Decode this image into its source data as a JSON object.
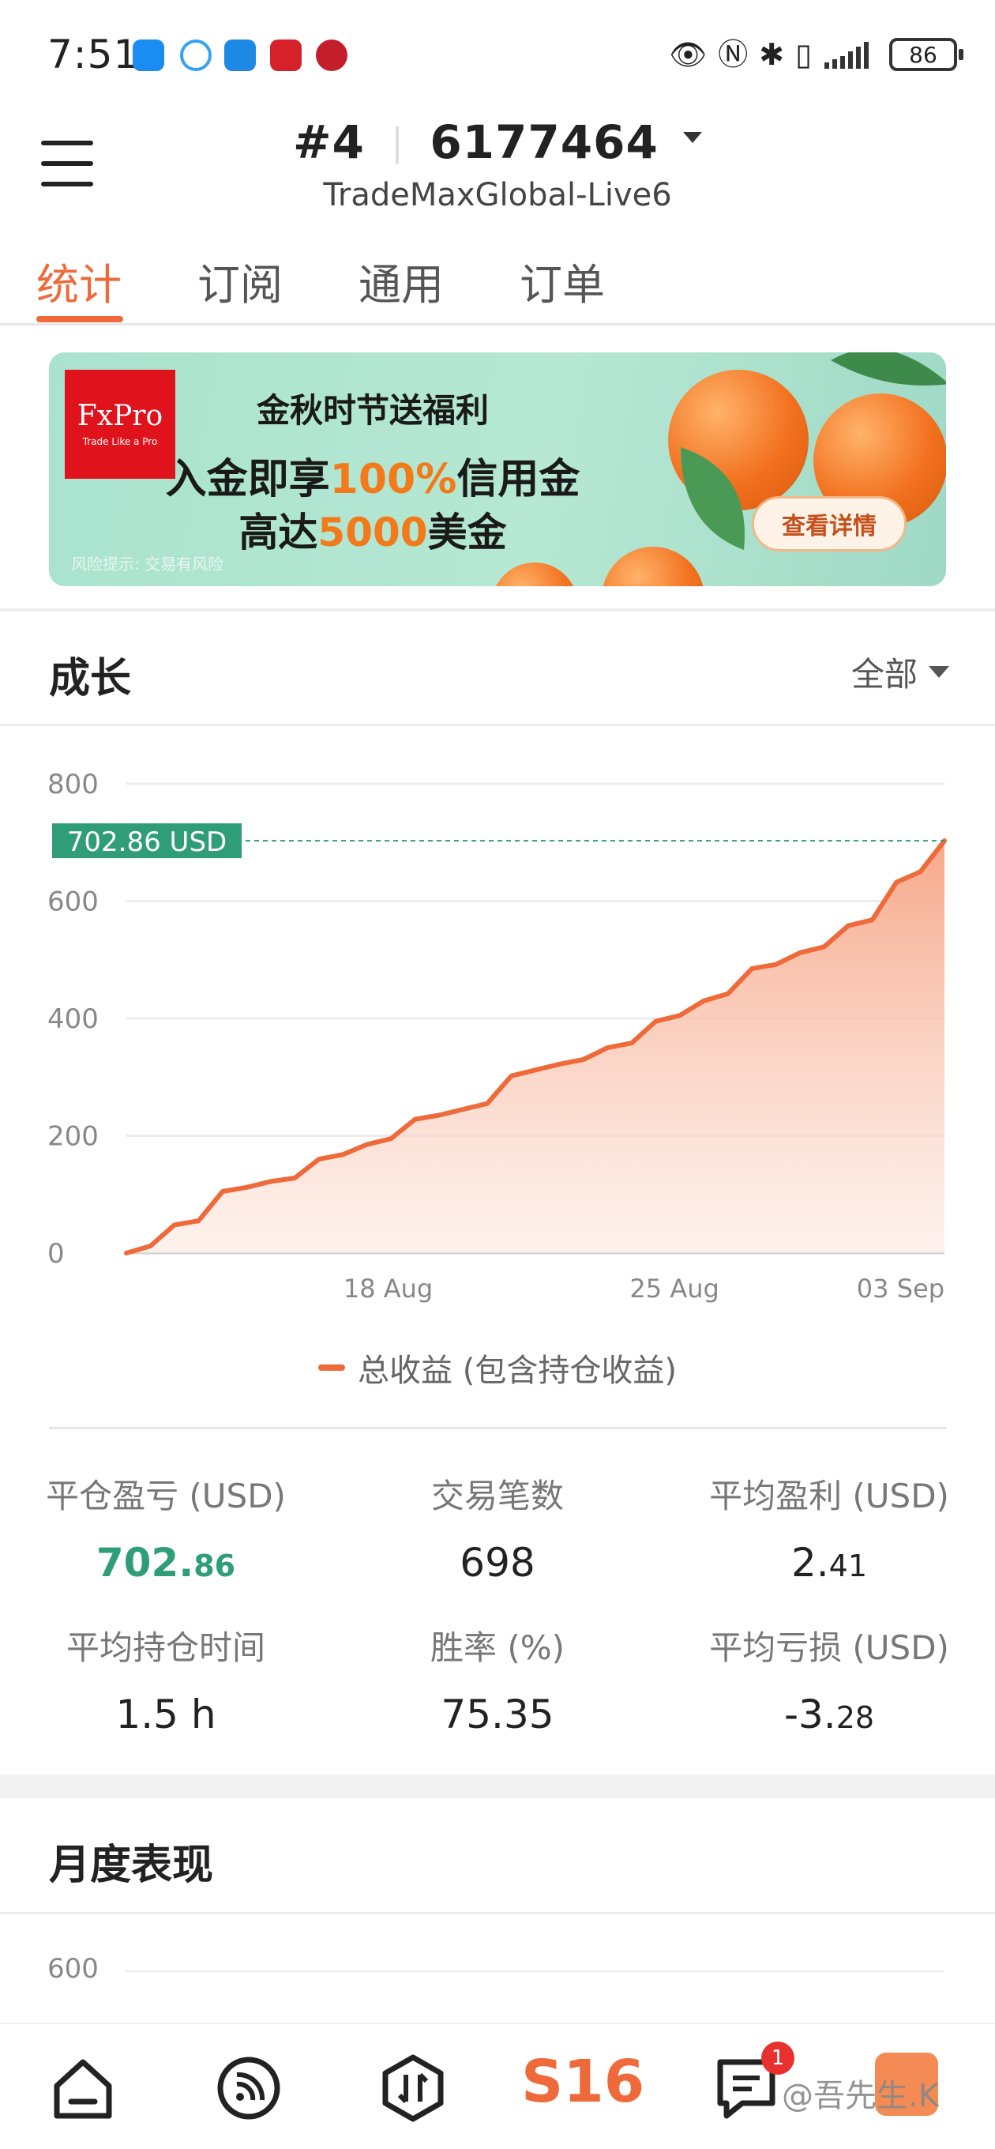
{
  "status_bar": {
    "time": "7:51",
    "battery": "86",
    "notification_icons": [
      "chat-icon",
      "weather-icon",
      "browser-icon",
      "news-icon",
      "metro-icon"
    ]
  },
  "header": {
    "account_prefix": "#4",
    "account_number": "6177464",
    "server": "TradeMaxGlobal-Live6"
  },
  "tabs": [
    {
      "label": "统计",
      "active": true
    },
    {
      "label": "订阅",
      "active": false
    },
    {
      "label": "通用",
      "active": false
    },
    {
      "label": "订单",
      "active": false
    }
  ],
  "banner": {
    "logo": "FxPro",
    "logo_tagline": "Trade Like a Pro",
    "line1": "金秋时节送福利",
    "line2_a": "入金即享",
    "line2_hl": "100%",
    "line2_b": "信用金",
    "line3_a": "高达",
    "line3_hl": "5000",
    "line3_b": "美金",
    "risk_notice": "风险提示: 交易有风险",
    "cta": "查看详情"
  },
  "growth": {
    "title": "成长",
    "filter": "全部",
    "current_label": "702.86 USD",
    "legend": "总收益 (包含持仓收益)"
  },
  "chart_data": {
    "type": "area",
    "y_ticks": [
      "800",
      "600",
      "400",
      "200",
      "0"
    ],
    "x_ticks": [
      "18 Aug",
      "25 Aug",
      "03 Sep"
    ],
    "ylim": [
      0,
      800
    ],
    "grid": true,
    "series": [
      {
        "name": "总收益 (包含持仓收益)",
        "color": "#ee6a3a",
        "values": [
          0,
          12,
          48,
          55,
          105,
          112,
          122,
          128,
          160,
          168,
          185,
          195,
          228,
          235,
          245,
          255,
          302,
          312,
          322,
          330,
          350,
          358,
          395,
          405,
          430,
          442,
          485,
          492,
          512,
          522,
          558,
          568,
          632,
          650,
          702.86
        ]
      }
    ]
  },
  "stats": {
    "closed_pl_label": "平仓盈亏 (USD)",
    "closed_pl_main": "702.",
    "closed_pl_dec": "86",
    "trades_label": "交易笔数",
    "trades_value": "698",
    "avg_profit_label": "平均盈利 (USD)",
    "avg_profit_main": "2.",
    "avg_profit_dec": "41",
    "avg_hold_label": "平均持仓时间",
    "avg_hold_value": "1.5 h",
    "win_rate_label": "胜率 (%)",
    "win_rate_value": "75.35",
    "avg_loss_label": "平均亏损 (USD)",
    "avg_loss_main": "-3.",
    "avg_loss_dec": "28"
  },
  "monthly": {
    "title": "月度表现",
    "y_tick": "600"
  },
  "bottom_nav": {
    "center_label": "S16",
    "badge": "1",
    "watermark": "@吾先生.K"
  }
}
